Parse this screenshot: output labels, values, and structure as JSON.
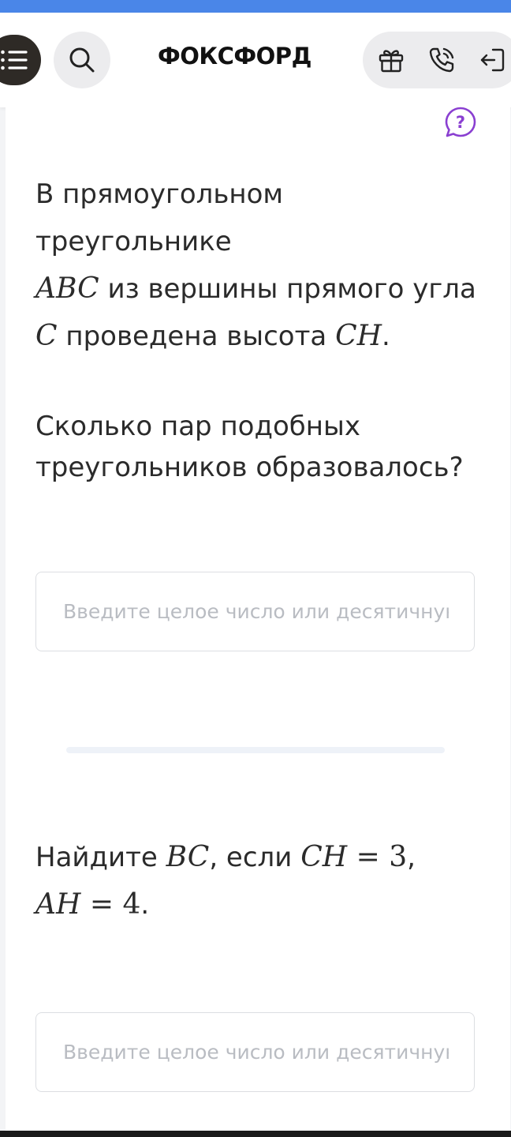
{
  "header": {
    "logo_text": "ФОКСФОРД",
    "icons": [
      "menu-icon",
      "search-icon",
      "gift-icon",
      "phone-icon",
      "login-icon"
    ]
  },
  "task1": {
    "text_1": "В прямоугольном треугольнике",
    "var_abc": "ABC",
    "text_2": " из вершины прямого угла",
    "var_c": "C",
    "text_3": " проведена высота ",
    "var_ch": "CH",
    "text_4": "."
  },
  "task2": {
    "question": "Сколько пар подобных треугольников образовалось?",
    "answer": {
      "value": "",
      "placeholder": "Введите целое число или десятичную дробь"
    }
  },
  "task3": {
    "text_1": "Найдите ",
    "var_bc": "BC",
    "text_2": ", если ",
    "var_ch": "CH",
    "eq_1": " = 3",
    "comma": ",",
    "var_ah": "AH",
    "eq_2": " = 4",
    "period": ".",
    "answer": {
      "value": "",
      "placeholder": "Введите целое число или десятичную дробь"
    }
  },
  "colors": {
    "top_strip": "#4a86e8",
    "menu_button": "#2e2a26",
    "help_icon": "#8a3fd1",
    "text": "#2b2b2b",
    "placeholder": "#b9bcc2"
  }
}
